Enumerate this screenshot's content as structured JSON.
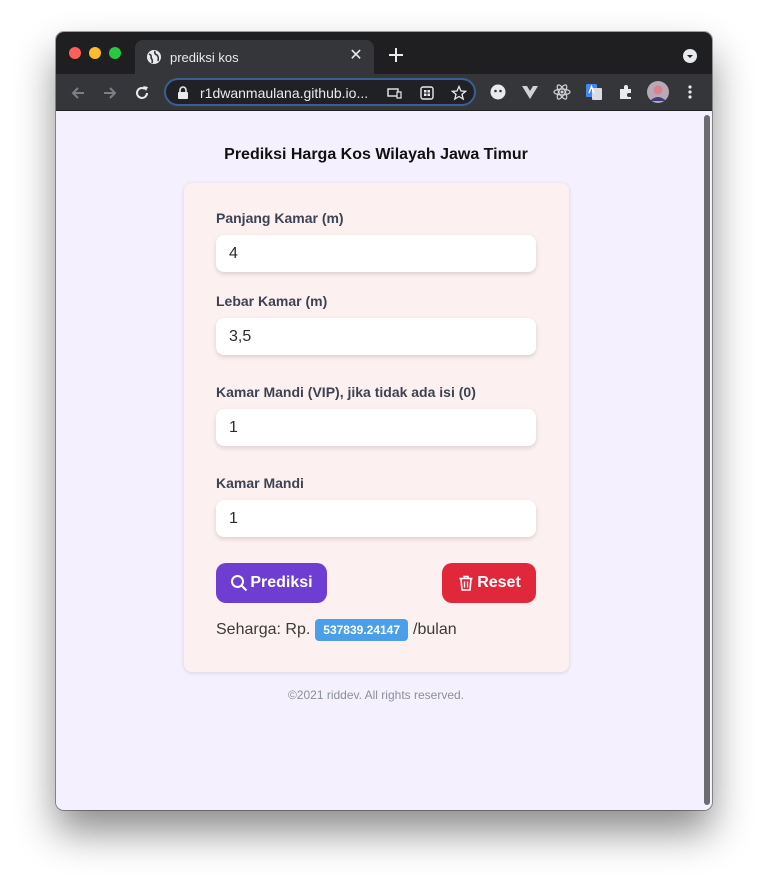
{
  "browser": {
    "tab_title": "prediksi kos",
    "url": "r1dwanmaulana.github.io..."
  },
  "page": {
    "heading": "Prediksi Harga Kos Wilayah Jawa Timur",
    "fields": [
      {
        "label": "Panjang Kamar (m)",
        "value": "4"
      },
      {
        "label": "Lebar Kamar (m)",
        "value": "3,5"
      },
      {
        "label": "Kamar Mandi (VIP), jika tidak ada isi (0)",
        "value": "1"
      },
      {
        "label": "Kamar Mandi",
        "value": "1"
      }
    ],
    "predict_label": "Prediksi",
    "reset_label": "Reset",
    "result": {
      "prefix": "Seharga: Rp.",
      "value": "537839.24147",
      "suffix": "/bulan"
    },
    "footer": "©2021 riddev. All rights reserved."
  },
  "colors": {
    "predict_button": "#6d3ed1",
    "reset_button": "#e0283a",
    "result_badge": "#4a9fe8",
    "page_background": "#f5f0fe",
    "card_background": "#fdf0f0"
  }
}
